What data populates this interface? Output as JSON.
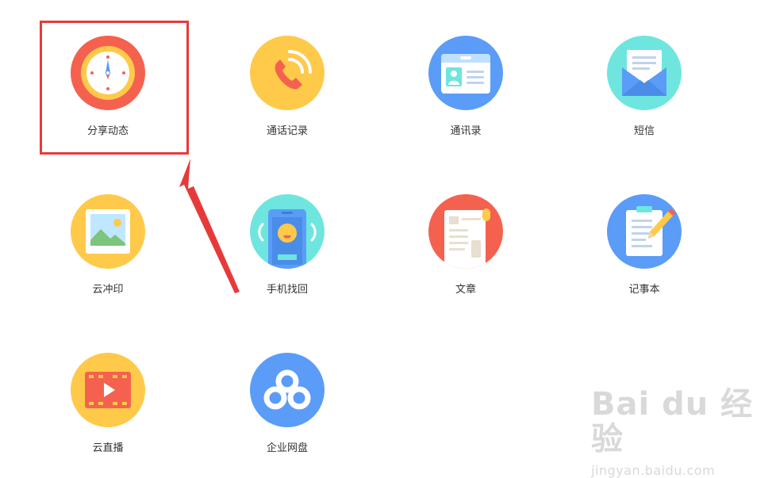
{
  "apps": [
    {
      "id": "share-feed",
      "label": "分享动态",
      "icon": "clock-icon",
      "color": "#f5614f"
    },
    {
      "id": "call-log",
      "label": "通话记录",
      "icon": "phone-icon",
      "color": "#ffc94a"
    },
    {
      "id": "contacts",
      "label": "通讯录",
      "icon": "contact-card-icon",
      "color": "#5a9cf8"
    },
    {
      "id": "sms",
      "label": "短信",
      "icon": "envelope-icon",
      "color": "#6ee6df"
    },
    {
      "id": "cloud-print",
      "label": "云冲印",
      "icon": "picture-icon",
      "color": "#ffc94a"
    },
    {
      "id": "find-phone",
      "label": "手机找回",
      "icon": "phone-locate-icon",
      "color": "#6ee6df"
    },
    {
      "id": "articles",
      "label": "文章",
      "icon": "scroll-icon",
      "color": "#f5614f"
    },
    {
      "id": "notepad",
      "label": "记事本",
      "icon": "clipboard-pencil-icon",
      "color": "#5a9cf8"
    },
    {
      "id": "cloud-live",
      "label": "云直播",
      "icon": "video-film-icon",
      "color": "#ffc94a"
    },
    {
      "id": "enterprise-disk",
      "label": "企业网盘",
      "icon": "cloud-disk-icon",
      "color": "#5a9cf8"
    }
  ],
  "highlight_color": "#e8393a",
  "watermark": {
    "brand": "Bai du 经验",
    "url": "jingyan.baidu.com"
  }
}
